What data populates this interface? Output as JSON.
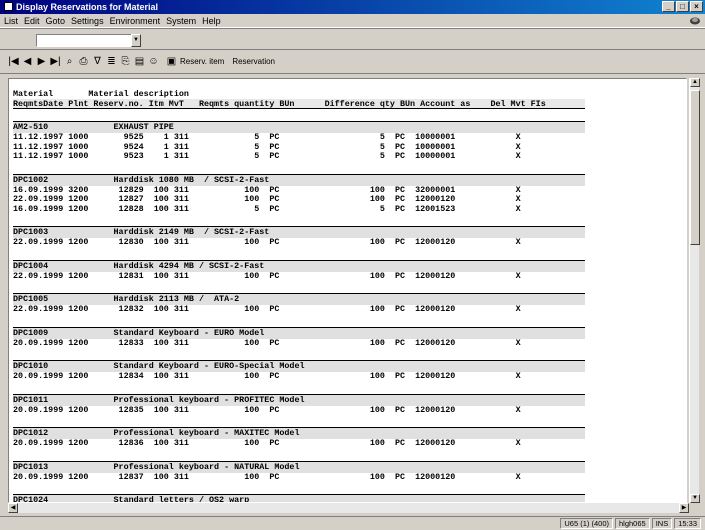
{
  "window": {
    "title": "Display Reservations for Material"
  },
  "menu": [
    "List",
    "Edit",
    "Goto",
    "Settings",
    "Environment",
    "System",
    "Help"
  ],
  "toolbar": {
    "reserv_item": "Reserv. item",
    "reservation": "Reservation"
  },
  "header": {
    "line1": "Material       Material description",
    "line2": "ReqmtsDate Plnt Reserv.no. Itm MvT   Reqmts quantity BUn      Difference qty BUn Account as    Del Mvt FIs"
  },
  "groups": [
    {
      "head": "AM2-510             EXHAUST PIPE",
      "rows": [
        "11.12.1997 1000       9525    1 311             5  PC                    5  PC  10000001            X",
        "11.12.1997 1000       9524    1 311             5  PC                    5  PC  10000001            X",
        "11.12.1997 1000       9523    1 311             5  PC                    5  PC  10000001            X"
      ]
    },
    {
      "head": "DPC1002             Harddisk 1080 MB  / SCSI-2-Fast",
      "rows": [
        "16.09.1999 3200      12829  100 311           100  PC                  100  PC  32000001            X",
        "22.09.1999 1200      12827  100 311           100  PC                  100  PC  12000120            X",
        "16.09.1999 1200      12828  100 311             5  PC                    5  PC  12001523            X"
      ]
    },
    {
      "head": "DPC1003             Harddisk 2149 MB  / SCSI-2-Fast",
      "rows": [
        "22.09.1999 1200      12830  100 311           100  PC                  100  PC  12000120            X"
      ]
    },
    {
      "head": "DPC1004             Harddisk 4294 MB / SCSI-2-Fast",
      "rows": [
        "22.09.1999 1200      12831  100 311           100  PC                  100  PC  12000120            X"
      ]
    },
    {
      "head": "DPC1005             Harddisk 2113 MB /  ATA-2",
      "rows": [
        "22.09.1999 1200      12832  100 311           100  PC                  100  PC  12000120            X"
      ]
    },
    {
      "head": "DPC1009             Standard Keyboard - EURO Model",
      "rows": [
        "20.09.1999 1200      12833  100 311           100  PC                  100  PC  12000120            X"
      ]
    },
    {
      "head": "DPC1010             Standard Keyboard - EURO-Special Model",
      "rows": [
        "20.09.1999 1200      12834  100 311           100  PC                  100  PC  12000120            X"
      ]
    },
    {
      "head": "DPC1011             Professional keyboard - PROFITEC Model",
      "rows": [
        "20.09.1999 1200      12835  100 311           100  PC                  100  PC  12000120            X"
      ]
    },
    {
      "head": "DPC1012             Professional keyboard - MAXITEC Model",
      "rows": [
        "20.09.1999 1200      12836  100 311           100  PC                  100  PC  12000120            X"
      ]
    },
    {
      "head": "DPC1013             Professional keyboard - NATURAL Model",
      "rows": [
        "20.09.1999 1200      12837  100 311           100  PC                  100  PC  12000120            X"
      ]
    },
    {
      "head": "DPC1024             Standard letters / OS2 warp",
      "rows": []
    }
  ],
  "status": {
    "system": "U65 (1) (400)",
    "host": "hlgh065",
    "mode": "INS",
    "time": "15:33"
  }
}
